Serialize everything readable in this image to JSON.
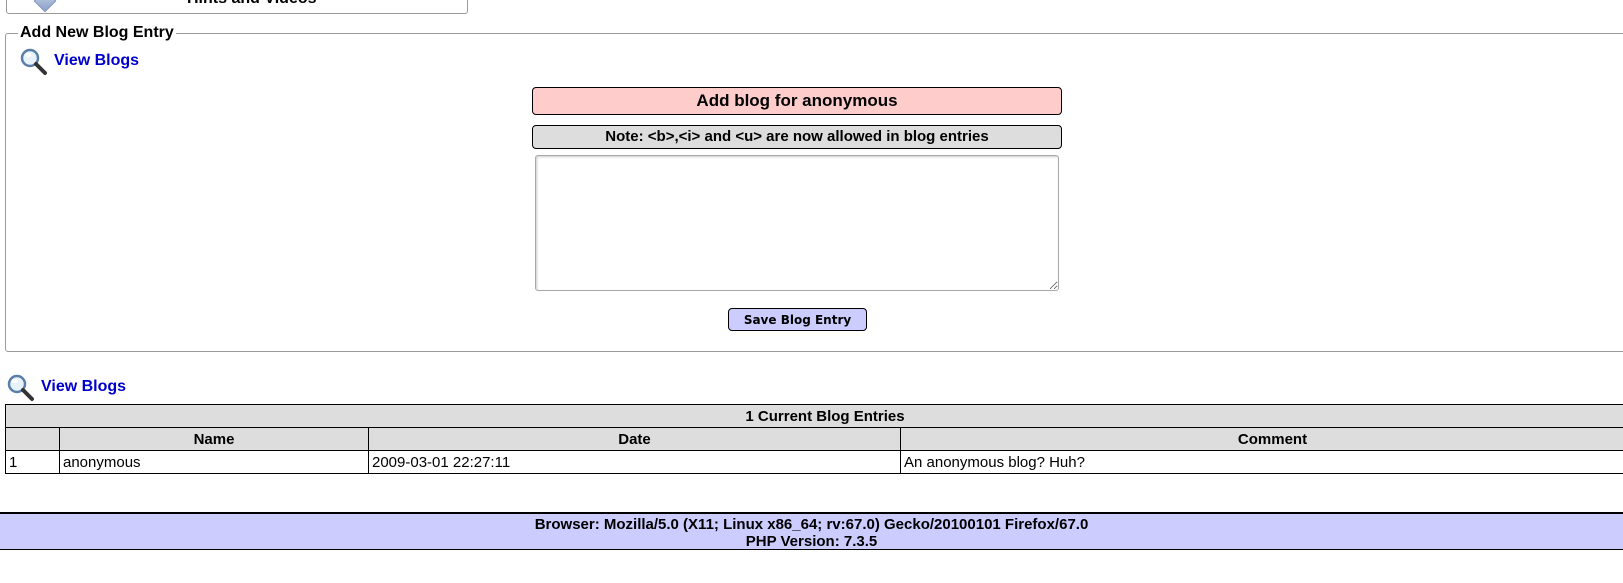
{
  "hints": {
    "label": "Hints and Videos"
  },
  "add_section": {
    "legend": "Add New Blog Entry",
    "view_link": "View Blogs",
    "header": "Add blog for anonymous",
    "note": "Note: <b>,<i> and <u> are now allowed in blog entries",
    "textarea_value": "",
    "save_label": "Save Blog Entry"
  },
  "list_section": {
    "view_link": "View Blogs",
    "caption": "1 Current Blog Entries",
    "columns": [
      "",
      "Name",
      "Date",
      "Comment"
    ],
    "rows": [
      {
        "num": "1",
        "name": "anonymous",
        "date": "2009-03-01 22:27:11",
        "comment": "An anonymous blog? Huh?"
      }
    ]
  },
  "footer": {
    "browser": "Browser: Mozilla/5.0 (X11; Linux x86_64; rv:67.0) Gecko/20100101 Firefox/67.0",
    "php": "PHP Version: 7.3.5"
  },
  "icons": {
    "view_blogs": "magnifier-icon",
    "hints": "diamond-icon"
  },
  "colors": {
    "link": "#0000cc",
    "header_bg": "#ffcccc",
    "note_bg": "#dddddd",
    "button_bg": "#ccccff",
    "footer_bg": "#ccccff"
  }
}
